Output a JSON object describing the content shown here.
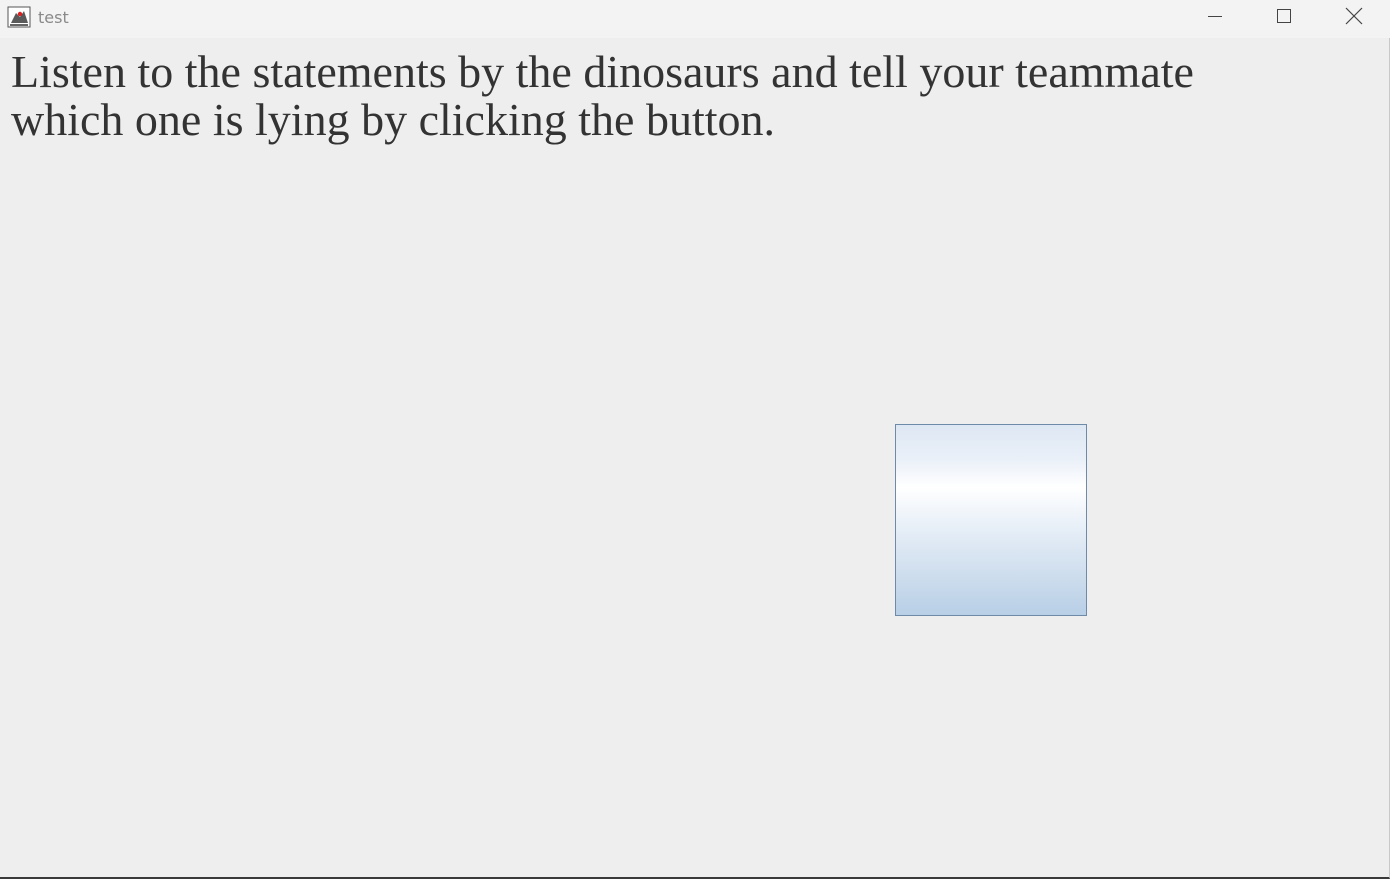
{
  "window": {
    "title": "test",
    "app_icon": "java-duke-icon"
  },
  "titlebar_controls": {
    "minimize_icon": "minimize-icon",
    "maximize_icon": "maximize-icon",
    "close_icon": "close-icon"
  },
  "main": {
    "instruction_line1": "Listen to the statements by the dinosaurs and tell your teammate",
    "instruction_line2": "which one is lying by clicking the button.",
    "button_label": ""
  },
  "colors": {
    "background": "#eeeeee",
    "text": "#333333",
    "button_border": "#6d8aa8"
  }
}
